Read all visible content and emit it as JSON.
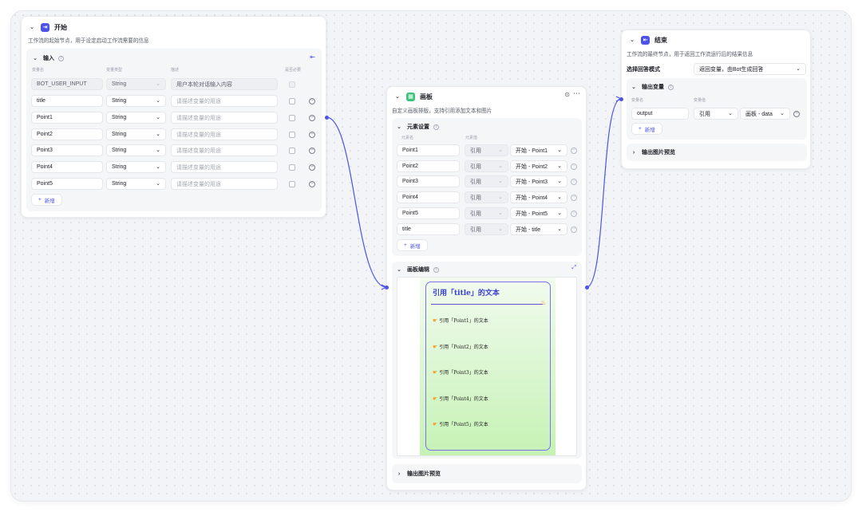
{
  "start_node": {
    "title": "开始",
    "description": "工作流的起始节点，用于设定启动工作流需要的信息",
    "input_section": "输入",
    "col_name": "变量名",
    "col_type": "变量类型",
    "col_desc": "描述",
    "col_required": "是否必要",
    "rows": [
      {
        "name": "BOT_USER_INPUT",
        "type": "String",
        "desc": "用户本轮对话输入内容"
      },
      {
        "name": "title",
        "type": "String",
        "desc": "请描述变量的用途"
      },
      {
        "name": "Point1",
        "type": "String",
        "desc": "请描述变量的用途"
      },
      {
        "name": "Point2",
        "type": "String",
        "desc": "请描述变量的用途"
      },
      {
        "name": "Point3",
        "type": "String",
        "desc": "请描述变量的用途"
      },
      {
        "name": "Point4",
        "type": "String",
        "desc": "请描述变量的用途"
      },
      {
        "name": "Point5",
        "type": "String",
        "desc": "请描述变量的用途"
      }
    ],
    "add_label": "新增"
  },
  "canvas_node": {
    "title": "画板",
    "description": "自定义画板排版，支持引用添加文本和图片",
    "element_section": "元素设置",
    "col_name": "元素名",
    "col_value": "元素值",
    "ref_label": "引用",
    "rows": [
      {
        "name": "Point1",
        "value": "开始 - Point1"
      },
      {
        "name": "Point2",
        "value": "开始 - Point2"
      },
      {
        "name": "Point3",
        "value": "开始 - Point3"
      },
      {
        "name": "Point4",
        "value": "开始 - Point4"
      },
      {
        "name": "Point5",
        "value": "开始 - Point5"
      },
      {
        "name": "title",
        "value": "开始 - title"
      }
    ],
    "add_label": "新增",
    "editor_section": "画板编辑",
    "card": {
      "title": "引用「title」的文本",
      "items": [
        "引用「Point1」的文本",
        "引用「Point2」的文本",
        "引用「Point3」的文本",
        "引用「Point4」的文本",
        "引用「Point5」的文本"
      ]
    },
    "preview_section": "输出图片预览"
  },
  "end_node": {
    "title": "结束",
    "description": "工作流的最终节点，用于返回工作流运行后的结果信息",
    "mode_label": "选择回答模式",
    "mode_value": "返回变量，由Bot生成回答",
    "output_section": "输出变量",
    "col_name": "变量名",
    "col_value": "变量值",
    "var_name": "output",
    "ref_label": "引用",
    "ref_value": "画板 - data",
    "add_label": "新增",
    "preview_section": "输出图片预览"
  },
  "colors": {
    "accent": "#4d53e8",
    "start_icon": "#4d53e8",
    "canvas_icon": "#3cc47c",
    "card_border": "#7b6ff0"
  }
}
